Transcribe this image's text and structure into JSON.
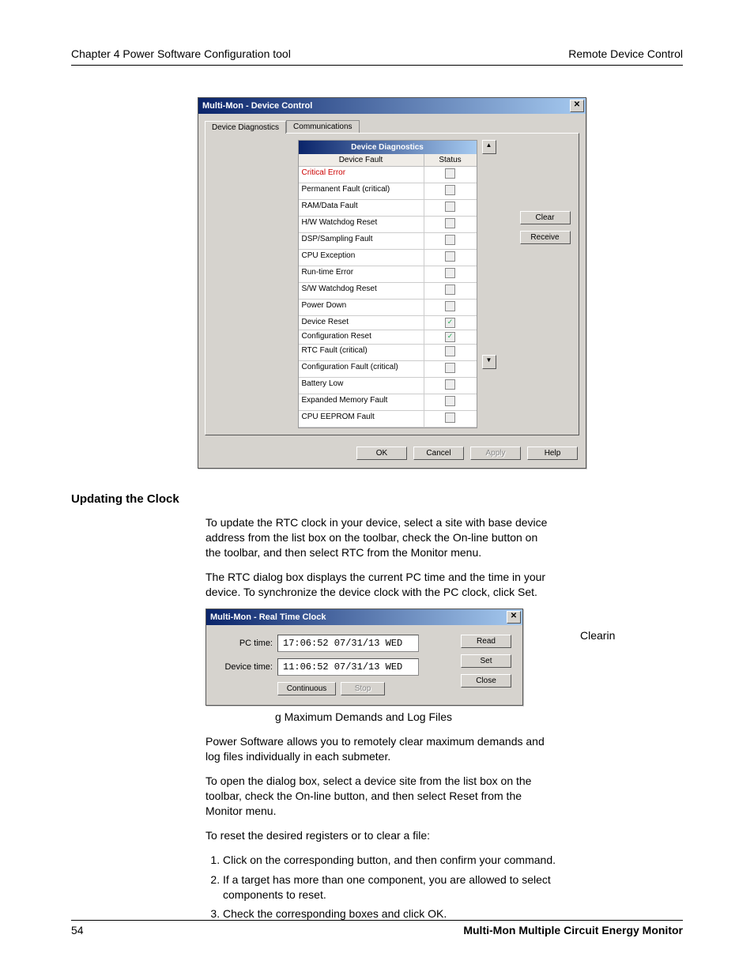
{
  "header": {
    "left": "Chapter 4 Power Software Configuration tool",
    "right": "Remote Device Control"
  },
  "dlg1": {
    "title": "Multi-Mon - Device Control",
    "tabs": [
      "Device Diagnostics",
      "Communications"
    ],
    "tableHeader": "Device Diagnostics",
    "col1": "Device Fault",
    "col2": "Status",
    "rows": [
      {
        "label": "Critical Error",
        "critical": true,
        "checked": false
      },
      {
        "label": "Permanent Fault (critical)",
        "critical": false,
        "checked": false
      },
      {
        "label": "RAM/Data Fault",
        "critical": false,
        "checked": false
      },
      {
        "label": "H/W Watchdog Reset",
        "critical": false,
        "checked": false
      },
      {
        "label": "DSP/Sampling Fault",
        "critical": false,
        "checked": false
      },
      {
        "label": "CPU Exception",
        "critical": false,
        "checked": false
      },
      {
        "label": "Run-time Error",
        "critical": false,
        "checked": false
      },
      {
        "label": "S/W Watchdog Reset",
        "critical": false,
        "checked": false
      },
      {
        "label": "Power Down",
        "critical": false,
        "checked": false
      },
      {
        "label": "Device Reset",
        "critical": false,
        "checked": true
      },
      {
        "label": "Configuration Reset",
        "critical": false,
        "checked": true
      },
      {
        "label": "RTC Fault (critical)",
        "critical": false,
        "checked": false
      },
      {
        "label": "Configuration Fault (critical)",
        "critical": false,
        "checked": false
      },
      {
        "label": "Battery Low",
        "critical": false,
        "checked": false
      },
      {
        "label": "Expanded Memory Fault",
        "critical": false,
        "checked": false
      },
      {
        "label": "CPU EEPROM Fault",
        "critical": false,
        "checked": false
      }
    ],
    "sideButtons": {
      "clear": "Clear",
      "receive": "Receive"
    },
    "bottomButtons": {
      "ok": "OK",
      "cancel": "Cancel",
      "apply": "Apply",
      "help": "Help"
    }
  },
  "section": {
    "title": "Updating the Clock"
  },
  "para1": "To update the RTC clock in your device, select a site with base device address from the list box on the toolbar, check the On-line button on the toolbar, and then select RTC from the Monitor menu.",
  "para2": "The RTC dialog box displays the current PC time and the time in your device. To synchronize the device clock with the PC clock, click Set.",
  "dlg2": {
    "title": "Multi-Mon - Real Time Clock",
    "pcLabel": "PC time:",
    "pcValue": "17:06:52 07/31/13 WED",
    "devLabel": "Device time:",
    "devValue": "11:06:52 07/31/13 WED",
    "buttons": {
      "read": "Read",
      "set": "Set",
      "close": "Close",
      "continuous": "Continuous",
      "stop": "Stop"
    }
  },
  "clearin": "Clearin",
  "caption": "g Maximum Demands and Log Files",
  "para3": "Power Software allows you to remotely clear maximum demands and log files individually in each submeter.",
  "para4": "To open the dialog box, select a device site from the list box on the toolbar, check the On-line button, and then select Reset from the Monitor menu.",
  "para5": "To reset the desired registers or to clear a file:",
  "steps": [
    "Click on the corresponding button, and then confirm your command.",
    "If a target has more than one component, you are allowed to select components to reset.",
    "Check the corresponding boxes and click OK."
  ],
  "footer": {
    "page": "54",
    "product": "Multi-Mon Multiple Circuit Energy Monitor"
  }
}
